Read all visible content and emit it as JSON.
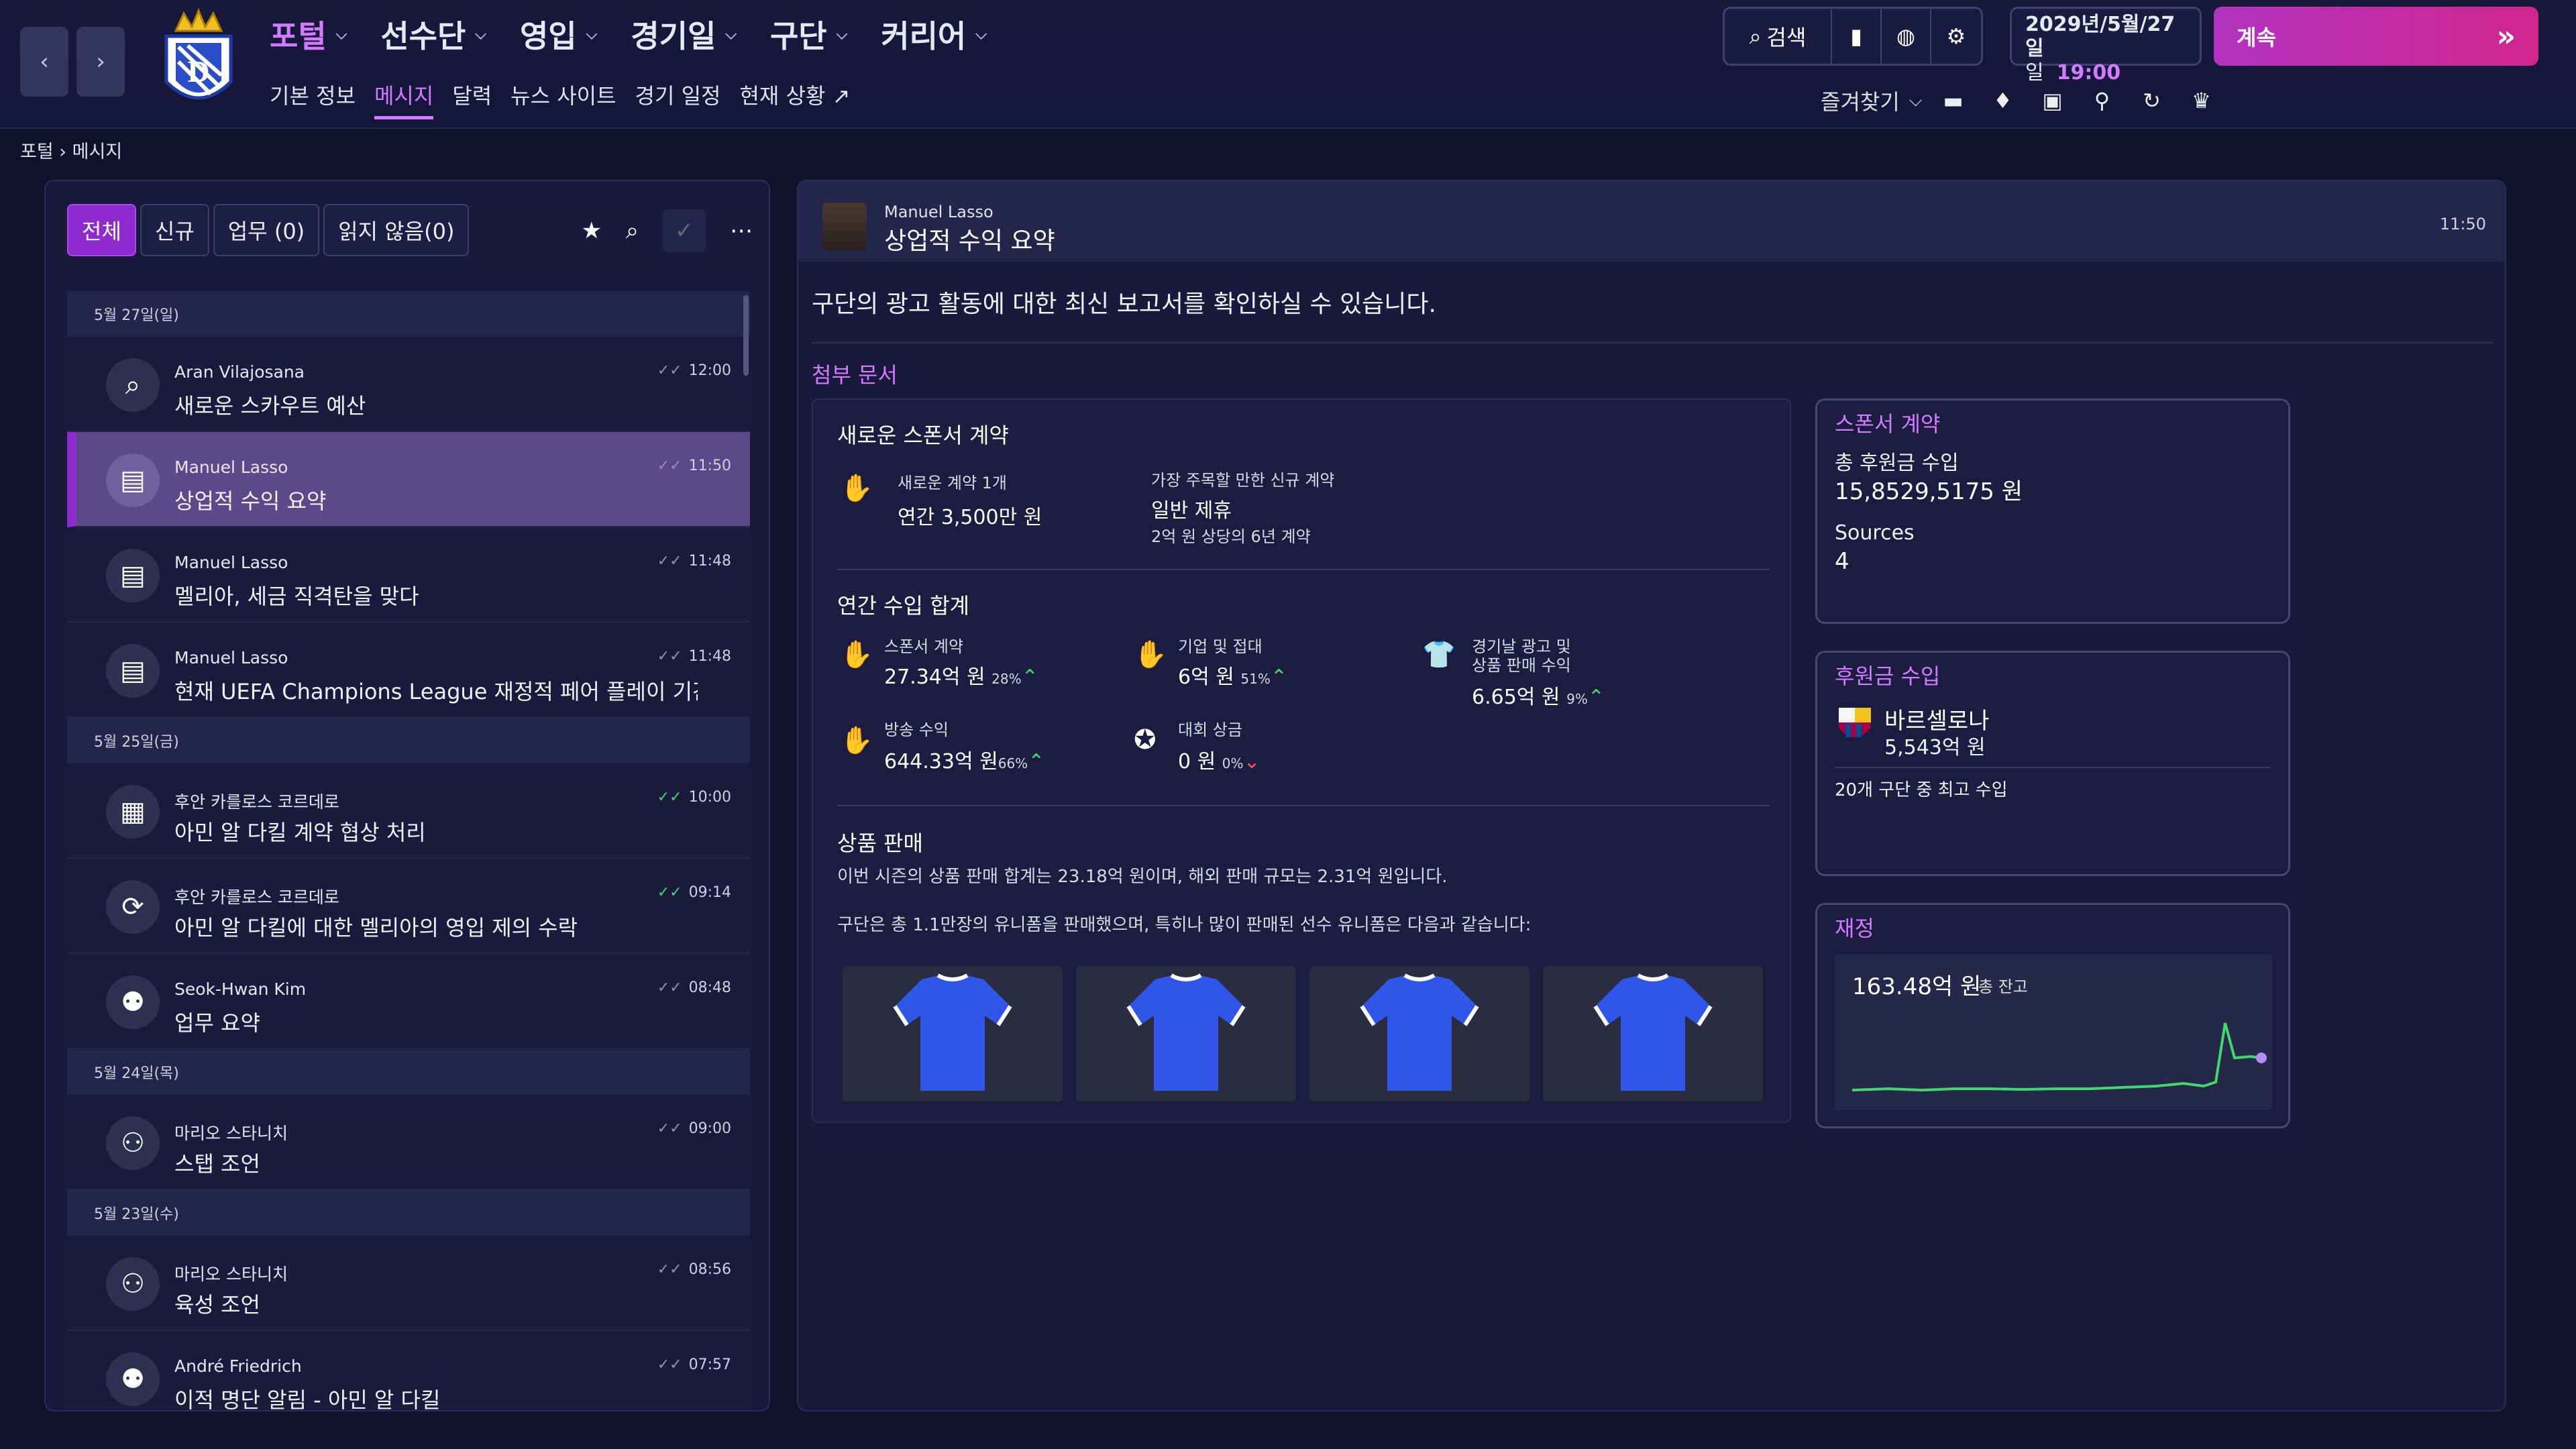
{
  "nav": {
    "items": [
      "포털",
      "선수단",
      "영입",
      "경기일",
      "구단",
      "커리어"
    ],
    "sub": [
      "기본 정보",
      "메시지",
      "달력",
      "뉴스 사이트",
      "경기 일정",
      "현재 상황"
    ],
    "search_label": "검색",
    "date_line1": "2029년/5월/27일",
    "date_weekday": "일",
    "date_time": "19:00",
    "continue_label": "계속",
    "favorites_label": "즐겨찾기"
  },
  "breadcrumb": {
    "root": "포털",
    "current": "메시지"
  },
  "filters": [
    "전체",
    "신규",
    "업무 (0)",
    "읽지 않음(0)"
  ],
  "list": {
    "groups": [
      {
        "date": "5월 27일(일)",
        "messages": [
          {
            "sender": "Aran Vilajosana",
            "subject": "새로운 스카우트 예산",
            "time": "12:00",
            "icon": "search-icon"
          },
          {
            "sender": "Manuel Lasso",
            "subject": "상업적 수익 요약",
            "time": "11:50",
            "icon": "briefcase-icon"
          },
          {
            "sender": "Manuel Lasso",
            "subject": "멜리아, 세금 직격탄을 맞다",
            "time": "11:48",
            "icon": "briefcase-icon"
          },
          {
            "sender": "Manuel Lasso",
            "subject": "현재 UEFA Champions League 재정적 페어 플레이 기간의 ...",
            "time": "11:48",
            "icon": "briefcase-icon"
          }
        ]
      },
      {
        "date": "5월 25일(금)",
        "messages": [
          {
            "sender": "후안 카를로스 코르데로",
            "subject": "아민 알 다킬 계약 협상 처리",
            "time": "10:00",
            "icon": "contract-icon"
          },
          {
            "sender": "후안 카를로스 코르데로",
            "subject": "아민 알 다킬에 대한 멜리아의 영입 제의 수락",
            "time": "09:14",
            "icon": "transfer-icon"
          },
          {
            "sender": "Seok-Hwan Kim",
            "subject": "업무 요약",
            "time": "08:48",
            "icon": "staff-icon"
          }
        ]
      },
      {
        "date": "5월 24일(목)",
        "messages": [
          {
            "sender": "마리오 스타니치",
            "subject": "스탭 조언",
            "time": "09:00",
            "icon": "group-icon"
          }
        ]
      },
      {
        "date": "5월 23일(수)",
        "messages": [
          {
            "sender": "마리오 스타니치",
            "subject": "육성 조언",
            "time": "08:56",
            "icon": "group-icon"
          },
          {
            "sender": "André Friedrich",
            "subject": "이적 명단 알림 - 아민 알 다킬",
            "time": "07:57",
            "icon": "staff-icon"
          }
        ]
      }
    ]
  },
  "message": {
    "from": "Manuel Lasso",
    "title": "상업적 수익 요약",
    "time": "11:50",
    "intro": "구단의 광고 활동에 대한 최신 보고서를 확인하실 수 있습니다.",
    "attach_label": "첨부 문서"
  },
  "doc": {
    "sponsor_title": "새로운 스폰서 계약",
    "new_count": "새로운 계약 1개",
    "new_value": "연간 3,500만 원",
    "notable_label": "가장 주목할 만한 신규 계약",
    "notable_value": "일반 제휴",
    "notable_detail": "2억 원 상당의 6년 계약",
    "annual_title": "연간 수입 합계",
    "sponsor_label": "스폰서 계약",
    "sponsor_val": "27.34억 원",
    "sponsor_pct": "28%",
    "corp_label": "기업 및 접대",
    "corp_val": "6억 원",
    "corp_pct": "51%",
    "ad_label1": "경기날 광고 및",
    "ad_label2": "상품 판매 수익",
    "ad_val": "6.65억 원",
    "ad_pct": "9%",
    "tv_label": "방송 수익",
    "tv_val": "644.33억 원",
    "tv_pct": "66%",
    "prize_label": "대회 상금",
    "prize_val": "0 원",
    "prize_pct": "0%",
    "merch_title": "상품 판매",
    "merch_text1": "이번 시즌의 상품 판매 합계는 23.18억 원이며, 해외 판매 규모는 2.31억 원입니다.",
    "merch_text2": "구단은 총 1.1만장의 유니폼을 판매했으며, 특히나 많이 판매된 선수 유니폼은 다음과 같습니다:"
  },
  "cards": {
    "sponsor": {
      "title": "스폰서 계약",
      "total_label": "총 후원금 수입",
      "total_value": "15,8529,5175 원",
      "sources_label": "Sources",
      "sources_value": "4"
    },
    "patron": {
      "title": "후원금 수입",
      "club": "바르셀로나",
      "amount": "5,543억 원",
      "note": "20개 구단 중 최고 수입"
    },
    "finance": {
      "title": "재정",
      "balance": "163.48억 원",
      "balance_label": "총 잔고"
    }
  },
  "colors": {
    "accent": "#d37bff",
    "up": "#3ed86c",
    "down": "#ff4a6a",
    "line": "#3ed86c",
    "kit": "#2f56e8"
  }
}
